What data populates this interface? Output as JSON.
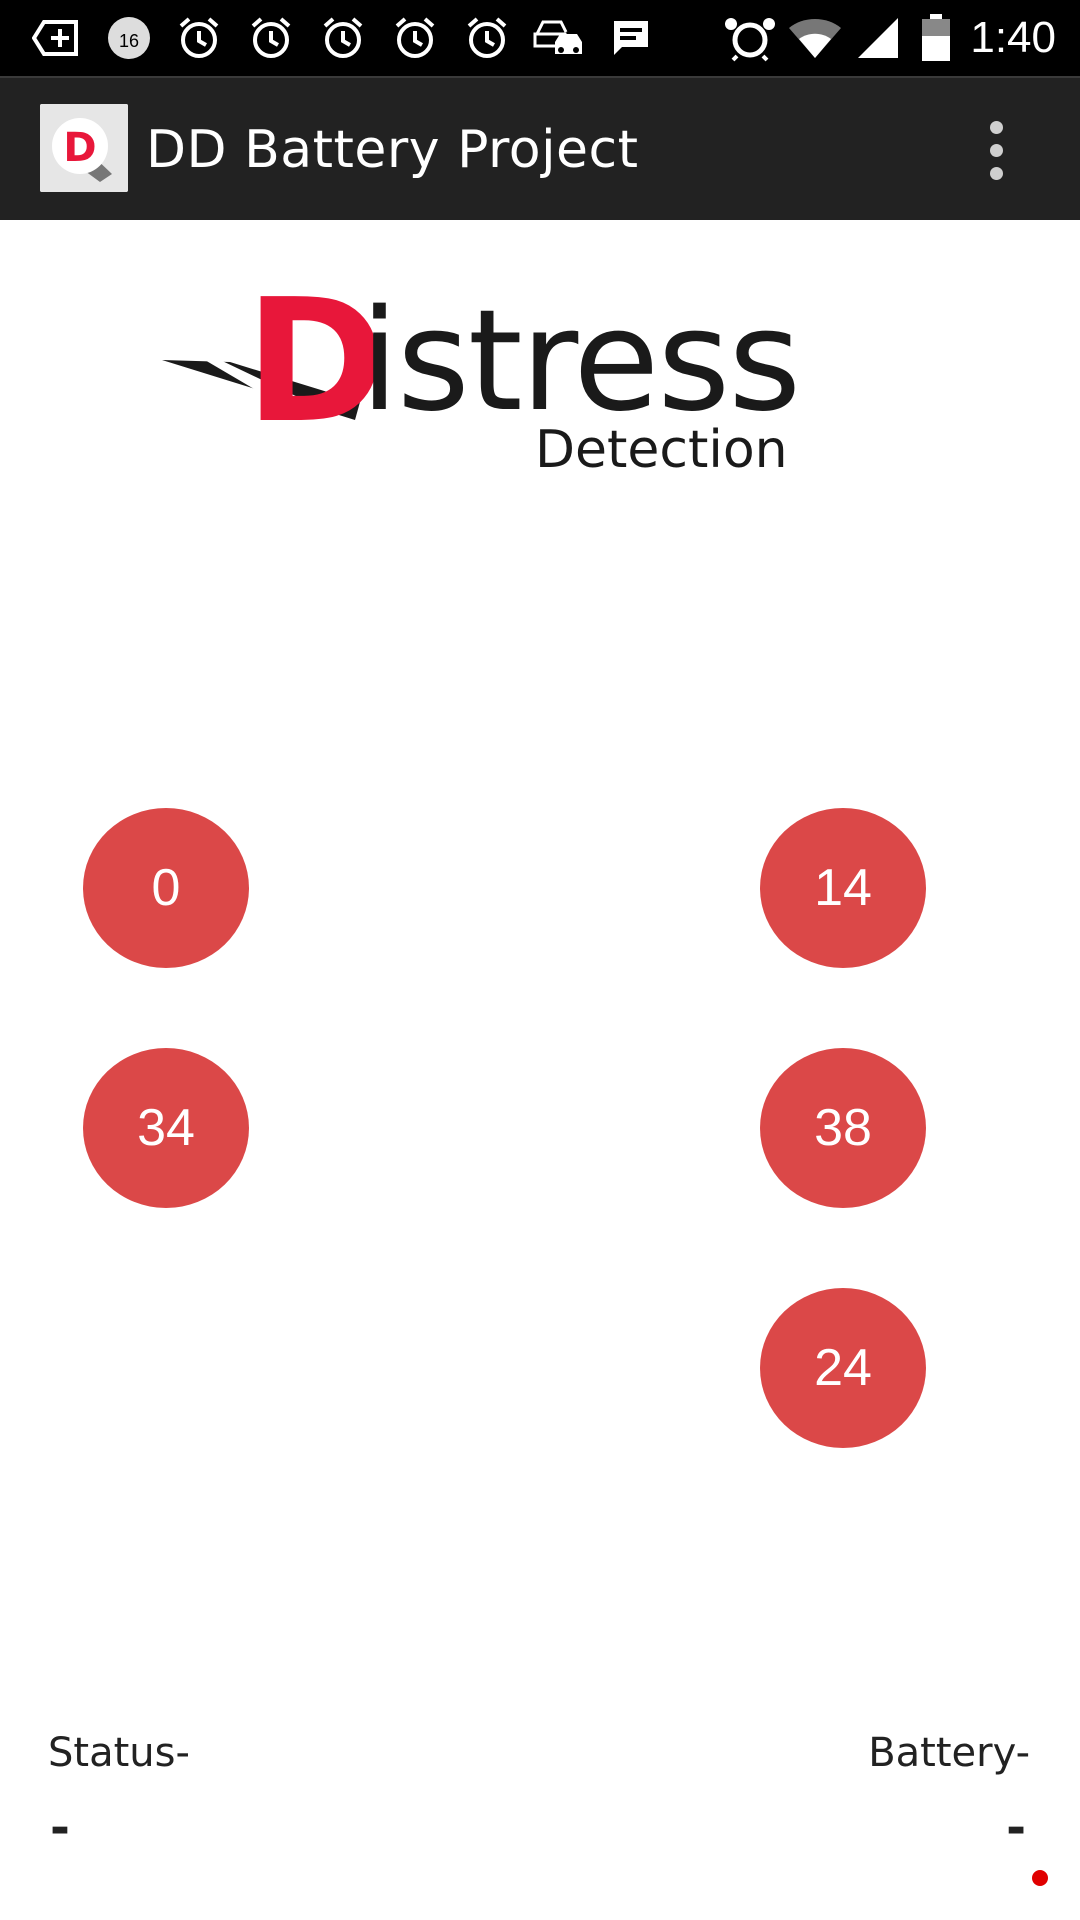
{
  "status_bar": {
    "time": "1:40",
    "notification_badge": "16",
    "icons": [
      "add-box-icon",
      "notification-count-icon",
      "alarm-icon",
      "alarm-icon",
      "alarm-icon",
      "alarm-icon",
      "alarm-icon",
      "traffic-icon",
      "message-icon",
      "alarm-clock-icon",
      "wifi-icon",
      "signal-icon",
      "battery-icon"
    ]
  },
  "app_bar": {
    "title": "DD Battery Project",
    "icon_letter": "D"
  },
  "logo": {
    "letter": "D",
    "word": "istress",
    "sub": "Detection"
  },
  "sensors": [
    {
      "value": "0"
    },
    {
      "value": "14"
    },
    {
      "value": "34"
    },
    {
      "value": "38"
    },
    {
      "value": "24"
    }
  ],
  "footer": {
    "status_label": "Status-",
    "status_value": "-",
    "battery_label": "Battery-",
    "battery_value": "-"
  },
  "colors": {
    "status_bar": "#000000",
    "app_bar": "#222222",
    "circle": "#db4848",
    "brand_red": "#e8173a",
    "dot": "#e00000"
  }
}
